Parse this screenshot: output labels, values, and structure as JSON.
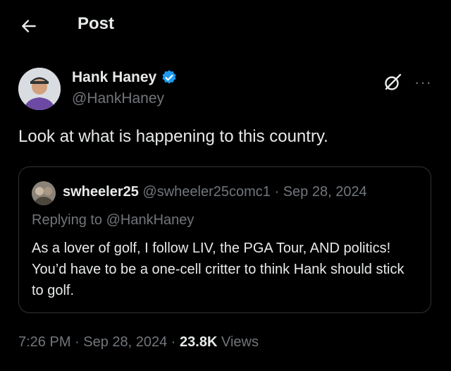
{
  "header": {
    "title": "Post",
    "back_icon": "arrow-left-icon"
  },
  "author": {
    "name": "Hank Haney",
    "handle": "@HankHaney",
    "verified_icon": "verified-badge-icon",
    "verified_color": "#1d9bf0",
    "grok_icon": "grok-icon",
    "more_icon": "more-dots-icon",
    "more_label": "···"
  },
  "post": {
    "text": "Look at what is happening to this country."
  },
  "quote": {
    "name": "swheeler25",
    "meta": "@swheeler25comc1 · Sep 28, 2024",
    "replying": "Replying to @HankHaney",
    "body": "As a lover of golf, I follow LIV, the PGA Tour, AND politics! You’d have to be a one-cell critter to think Hank should stick to golf."
  },
  "footer": {
    "time": "7:26 PM · Sep 28, 2024 · ",
    "views_count": "23.8K",
    "views_label": " Views"
  },
  "colors": {
    "background": "#000000",
    "text": "#e7e9ea",
    "muted": "#71767b",
    "border": "#2f3336"
  }
}
